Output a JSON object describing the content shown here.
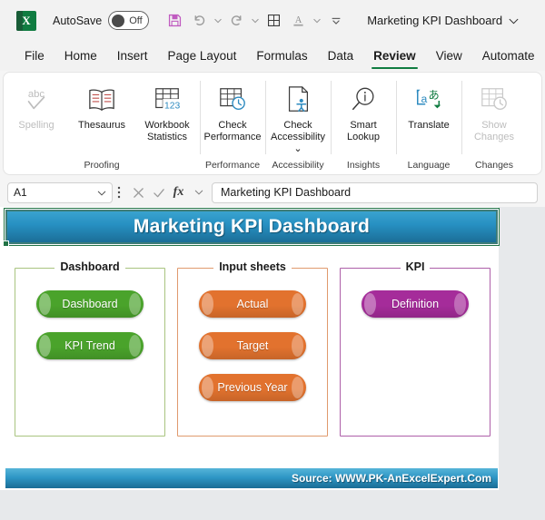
{
  "titlebar": {
    "app_icon": "excel-icon",
    "app_letter": "X",
    "autosave_label": "AutoSave",
    "autosave_state": "Off",
    "quick_access": [
      {
        "name": "save-icon",
        "label": "Save"
      },
      {
        "name": "undo-icon",
        "label": "Undo"
      },
      {
        "name": "redo-icon",
        "label": "Redo"
      },
      {
        "name": "borders-icon",
        "label": "Borders"
      },
      {
        "name": "font-color-icon",
        "label": "Font Color"
      },
      {
        "name": "customize-quick-access-icon",
        "label": "Customize Quick Access Toolbar"
      }
    ],
    "document_title": "Marketing KPI Dashboard",
    "title_chevron": "chevron-down-icon"
  },
  "ribbon": {
    "tabs": [
      {
        "label": "File",
        "active": false
      },
      {
        "label": "Home",
        "active": false
      },
      {
        "label": "Insert",
        "active": false
      },
      {
        "label": "Page Layout",
        "active": false
      },
      {
        "label": "Formulas",
        "active": false
      },
      {
        "label": "Data",
        "active": false
      },
      {
        "label": "Review",
        "active": true
      },
      {
        "label": "View",
        "active": false
      },
      {
        "label": "Automate",
        "active": false
      }
    ],
    "active_tab_accent": "#107c41",
    "groups": [
      {
        "name": "proofing",
        "label": "Proofing",
        "items": [
          {
            "name": "spelling",
            "label": "Spelling",
            "icon": "abc-check-icon",
            "disabled": true
          },
          {
            "name": "thesaurus",
            "label": "Thesaurus",
            "icon": "book-icon",
            "disabled": false
          },
          {
            "name": "workbook-statistics",
            "label": "Workbook\nStatistics",
            "label_l1": "Workbook",
            "label_l2": "Statistics",
            "icon": "table-123-icon",
            "disabled": false
          }
        ]
      },
      {
        "name": "performance",
        "label": "Performance",
        "items": [
          {
            "name": "check-performance",
            "label_l1": "Check",
            "label_l2": "Performance",
            "icon": "table-clock-icon",
            "disabled": false
          }
        ]
      },
      {
        "name": "accessibility",
        "label": "Accessibility",
        "items": [
          {
            "name": "check-accessibility",
            "label_l1": "Check",
            "label_l2": "Accessibility ⌄",
            "icon": "accessibility-page-icon",
            "disabled": false
          }
        ]
      },
      {
        "name": "insights",
        "label": "Insights",
        "items": [
          {
            "name": "smart-lookup",
            "label_l1": "Smart",
            "label_l2": "Lookup",
            "icon": "magnifier-info-icon",
            "disabled": false
          }
        ]
      },
      {
        "name": "language",
        "label": "Language",
        "items": [
          {
            "name": "translate",
            "label_l1": "Translate",
            "label_l2": "",
            "icon": "translate-icon",
            "disabled": false
          }
        ]
      },
      {
        "name": "changes",
        "label": "Changes",
        "items": [
          {
            "name": "show-changes",
            "label_l1": "Show",
            "label_l2": "Changes",
            "icon": "table-history-icon",
            "disabled": true
          }
        ]
      }
    ]
  },
  "formula_bar": {
    "name_box_value": "A1",
    "name_box_chevron": "chevron-down-icon",
    "cancel_icon": "close-icon",
    "enter_icon": "check-icon",
    "function_icon": "fx-icon",
    "function_chevron": "chevron-down-icon",
    "formula_value": "Marketing KPI Dashboard"
  },
  "worksheet": {
    "banner_title": "Marketing KPI Dashboard",
    "source_text": "Source: WWW.PK-AnExcelExpert.Com",
    "banner_gradient_top": "#3aa3cf",
    "banner_gradient_bottom": "#1b6e97",
    "groups": [
      {
        "name": "dashboard",
        "title": "Dashboard",
        "border_color": "#a9c47f",
        "buttons": [
          {
            "name": "dashboard",
            "label": "Dashboard",
            "color": "#4aa32b"
          },
          {
            "name": "kpi-trend",
            "label": "KPI Trend",
            "color": "#4aa32b"
          }
        ]
      },
      {
        "name": "input-sheets",
        "title": "Input sheets",
        "border_color": "#e09a6e",
        "buttons": [
          {
            "name": "actual",
            "label": "Actual",
            "color": "#e2722e"
          },
          {
            "name": "target",
            "label": "Target",
            "color": "#e2722e"
          },
          {
            "name": "previous-year",
            "label": "Previous Year",
            "color": "#e2722e"
          }
        ]
      },
      {
        "name": "kpi",
        "title": "KPI",
        "border_color": "#ad5fa8",
        "buttons": [
          {
            "name": "definition",
            "label": "Definition",
            "color": "#a52c9a"
          }
        ]
      }
    ]
  }
}
